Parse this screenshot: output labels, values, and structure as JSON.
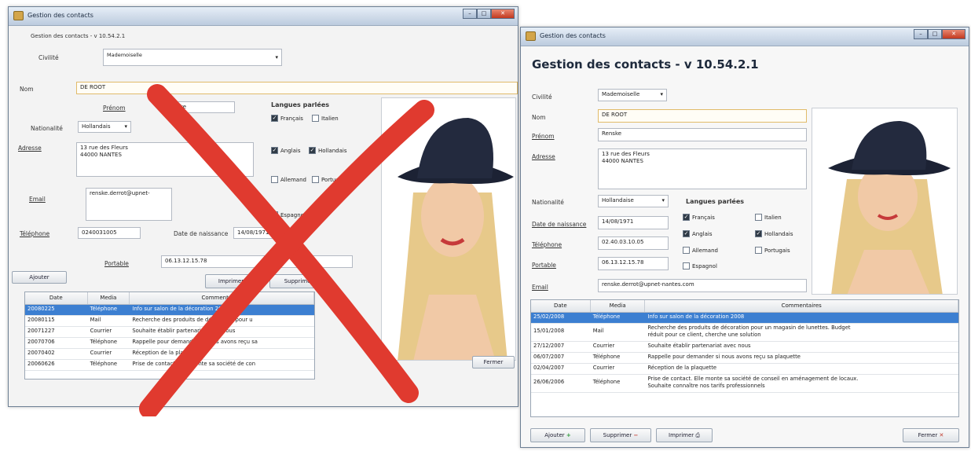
{
  "old": {
    "window_title": "Gestion des contacts",
    "header": "Gestion des contacts - v 10.54.2.1",
    "civilite_label": "Civilité",
    "civilite_value": "Mademoiselle",
    "nom_label": "Nom",
    "nom_value": "DE ROOT",
    "prenom_label": "Prénom",
    "prenom_value": "Renske",
    "langues_title": "Langues parlées",
    "languages": [
      {
        "label": "Français",
        "checked": true
      },
      {
        "label": "Italien",
        "checked": false
      },
      {
        "label": "Anglais",
        "checked": true
      },
      {
        "label": "Hollandais",
        "checked": true
      },
      {
        "label": "Allemand",
        "checked": false
      },
      {
        "label": "Portugais",
        "checked": false
      },
      {
        "label": "Espagnol",
        "checked": false
      }
    ],
    "nationalite_label": "Nationalité",
    "nationalite_value": "Hollandais",
    "adresse_label": "Adresse",
    "adresse_value": "13 rue des Fleurs\n44000 NANTES",
    "email_label": "Email",
    "email_value": "renske.derrot@upnet-",
    "telephone_label": "Téléphone",
    "telephone_value": "0240031005",
    "naissance_label": "Date de naissance",
    "naissance_value": "14/08/1971",
    "portable_label": "Portable",
    "portable_value": "06.13.12.15.78",
    "btn_ajouter": "Ajouter",
    "btn_imprimer": "Imprimer",
    "btn_supprimer": "Supprimer",
    "columns": [
      "Date",
      "Media",
      "Commentaires"
    ],
    "rows": [
      {
        "date": "20080225",
        "media": "Téléphone",
        "comment": "Info sur salon de la décoration 2008"
      },
      {
        "date": "20080115",
        "media": "Mail",
        "comment": "Recherche des produits de décoration pour u"
      },
      {
        "date": "20071227",
        "media": "Courrier",
        "comment": "Souhaite établir partenariat avec nous"
      },
      {
        "date": "20070706",
        "media": "Téléphone",
        "comment": "Rappelle pour demander si nous avons reçu sa"
      },
      {
        "date": "20070402",
        "media": "Courrier",
        "comment": "Réception de la plaquette"
      },
      {
        "date": "20060626",
        "media": "Téléphone",
        "comment": "Prise de contact. Elle monte sa société de con"
      }
    ]
  },
  "new": {
    "window_title": "Gestion des contacts",
    "header": "Gestion des contacts - v 10.54.2.1",
    "civilite_label": "Civilité",
    "civilite_value": "Mademoiselle",
    "nom_label": "Nom",
    "nom_value": "DE ROOT",
    "prenom_label": "Prénom",
    "prenom_value": "Renske",
    "adresse_label": "Adresse",
    "adresse_value": "13 rue des Fleurs\n44000 NANTES",
    "nationalite_label": "Nationalité",
    "nationalite_value": "Hollandaise",
    "langues_title": "Langues parlées",
    "languages": [
      {
        "label": "Français",
        "checked": true
      },
      {
        "label": "Italien",
        "checked": false
      },
      {
        "label": "Anglais",
        "checked": true
      },
      {
        "label": "Hollandais",
        "checked": true
      },
      {
        "label": "Allemand",
        "checked": false
      },
      {
        "label": "Portugais",
        "checked": false
      },
      {
        "label": "Espagnol",
        "checked": false
      }
    ],
    "naissance_label": "Date de naissance",
    "naissance_value": "14/08/1971",
    "telephone_label": "Téléphone",
    "telephone_value": "02.40.03.10.05",
    "portable_label": "Portable",
    "portable_value": "06.13.12.15.78",
    "email_label": "Email",
    "email_value": "renske.derrot@upnet-nantes.com",
    "columns": [
      "Date",
      "Media",
      "Commentaires"
    ],
    "rows": [
      {
        "date": "25/02/2008",
        "media": "Téléphone",
        "comment": "Info sur salon de la décoration 2008"
      },
      {
        "date": "15/01/2008",
        "media": "Mail",
        "comment": "Recherche des produits de décoration pour un magasin de lunettes. Budget\nréduit pour ce client, cherche une solution"
      },
      {
        "date": "27/12/2007",
        "media": "Courrier",
        "comment": "Souhaite établir partenariat avec nous"
      },
      {
        "date": "06/07/2007",
        "media": "Téléphone",
        "comment": "Rappelle pour demander si nous avons reçu sa plaquette"
      },
      {
        "date": "02/04/2007",
        "media": "Courrier",
        "comment": "Réception de la plaquette"
      },
      {
        "date": "26/06/2006",
        "media": "Téléphone",
        "comment": "Prise de contact. Elle monte sa société de conseil en aménagement de locaux.\nSouhaite connaître nos tarifs professionnels"
      }
    ],
    "btn_ajouter": "Ajouter",
    "btn_supprimer": "Supprimer",
    "btn_imprimer": "Imprimer",
    "btn_fermer": "Fermer"
  },
  "colors": {
    "accent": "#3c7fd1",
    "cross": "#e03a2f",
    "titlebar": "#bccbde"
  }
}
